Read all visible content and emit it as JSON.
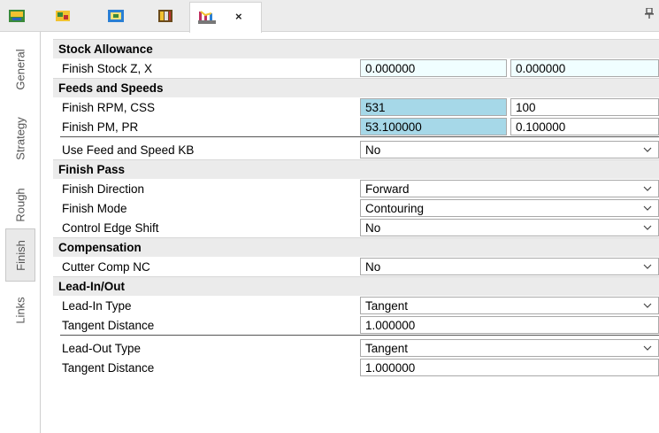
{
  "toolbar": {
    "buttons": [
      "toolpath-icon",
      "stock-icon",
      "tool-icon",
      "library-icon"
    ],
    "active_tab_icon": "lathe-finish-icon",
    "close_label": "×",
    "pin_icon": "pin-icon"
  },
  "side_tabs": [
    {
      "label": "General",
      "active": false
    },
    {
      "label": "Strategy",
      "active": false
    },
    {
      "label": "Rough",
      "active": false
    },
    {
      "label": "Finish",
      "active": true
    },
    {
      "label": "Links",
      "active": false
    }
  ],
  "sections": {
    "stock": {
      "title": "Stock Allowance",
      "finish_stock": {
        "label": "Finish Stock Z, X",
        "z": "0.000000",
        "x": "0.000000"
      }
    },
    "feeds": {
      "title": "Feeds and Speeds",
      "rpm_css": {
        "label": "Finish RPM, CSS",
        "rpm": "531",
        "css": "100"
      },
      "pm_pr": {
        "label": "Finish PM, PR",
        "pm": "53.100000",
        "pr": "0.100000"
      },
      "use_kb": {
        "label": "Use Feed and Speed KB",
        "value": "No"
      }
    },
    "pass": {
      "title": "Finish Pass",
      "direction": {
        "label": "Finish Direction",
        "value": "Forward"
      },
      "mode": {
        "label": "Finish Mode",
        "value": "Contouring"
      },
      "edge_shift": {
        "label": "Control Edge Shift",
        "value": "No"
      }
    },
    "comp": {
      "title": "Compensation",
      "cutter_comp": {
        "label": "Cutter Comp NC",
        "value": "No"
      }
    },
    "lead": {
      "title": "Lead-In/Out",
      "in_type": {
        "label": "Lead-In Type",
        "value": "Tangent"
      },
      "in_dist": {
        "label": "Tangent Distance",
        "value": "1.000000"
      },
      "out_type": {
        "label": "Lead-Out Type",
        "value": "Tangent"
      },
      "out_dist": {
        "label": "Tangent Distance",
        "value": "1.000000"
      }
    }
  },
  "colors": {
    "selected_field": "#a6d8e8",
    "input_field": "#f0feff",
    "section_header": "#ebebeb"
  }
}
